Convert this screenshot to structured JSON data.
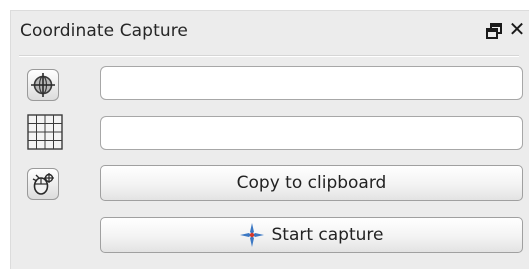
{
  "panel": {
    "title": "Coordinate Capture",
    "float_icon": "float-window-icon",
    "close_icon": "close-icon",
    "close_glyph": "✕"
  },
  "rows": [
    {
      "icon": "globe-crs-icon",
      "value": ""
    },
    {
      "icon": "grid-crs-icon",
      "value": ""
    }
  ],
  "buttons": {
    "settings_icon": "mouse-tracking-icon",
    "copy_label": "Copy to clipboard",
    "start_label": "Start capture",
    "start_icon": "crosshair-icon"
  },
  "colors": {
    "panel_bg": "#ececec",
    "crosshair_blue": "#3b78c4",
    "crosshair_red": "#d43a2c"
  }
}
